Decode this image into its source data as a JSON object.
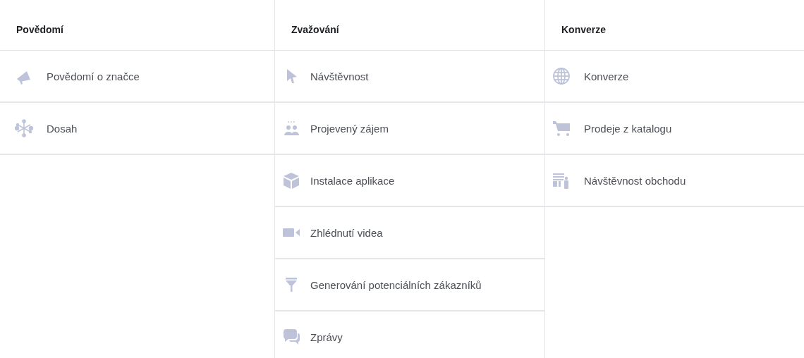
{
  "columns": [
    {
      "title": "Povědomí",
      "items": [
        {
          "kind": "megaphone",
          "label": "Povědomí o značce"
        },
        {
          "kind": "reach",
          "label": "Dosah"
        }
      ]
    },
    {
      "title": "Zvažování",
      "items": [
        {
          "kind": "pointer",
          "label": "Návštěvnost"
        },
        {
          "kind": "people",
          "label": "Projevený zájem"
        },
        {
          "kind": "box",
          "label": "Instalace aplikace"
        },
        {
          "kind": "video",
          "label": "Zhlédnutí videa"
        },
        {
          "kind": "funnel",
          "label": "Generování potenciálních zákazníků"
        },
        {
          "kind": "chat",
          "label": "Zprávy"
        }
      ]
    },
    {
      "title": "Konverze",
      "items": [
        {
          "kind": "globe",
          "label": "Konverze"
        },
        {
          "kind": "cart",
          "label": "Prodeje z katalogu"
        },
        {
          "kind": "store",
          "label": "Návštěvnost obchodu"
        }
      ]
    }
  ]
}
